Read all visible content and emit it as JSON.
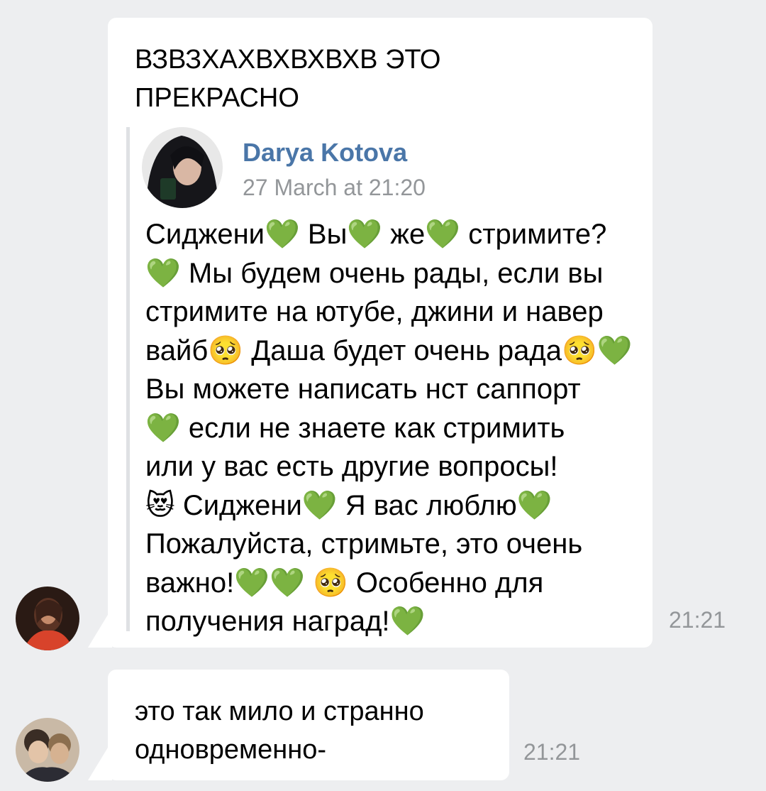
{
  "messages": [
    {
      "text": "ВЗВЗХАХВХВХВХВ ЭТО\nПРЕКРАСНО",
      "time": "21:21",
      "forwarded": {
        "author": "Darya Kotova",
        "date": "27 March at 21:20",
        "text": "Сиджени💚 Вы💚 же💚 стримите?\n💚 Мы будем очень рады, если вы\nстримите на ютубе, джини и навер\nвайб🥺 Даша будет очень рада🥺💚\nВы можете написать нст саппорт\n💚 если не знаете как стримить\nили у вас есть другие вопросы!\n😻 Сиджени💚 Я вас люблю💚\nПожалуйста, стримьте, это очень\nважно!💚💚 🥺 Особенно для\nполучения наград!💚"
      }
    },
    {
      "text": "это так мило и странно\nодновременно-",
      "time": "21:21"
    }
  ],
  "colors": {
    "background": "#edeef0",
    "bubble": "#ffffff",
    "author_link": "#4a76a8",
    "meta_gray": "#939699",
    "quote_bar": "#dfe1e4"
  }
}
